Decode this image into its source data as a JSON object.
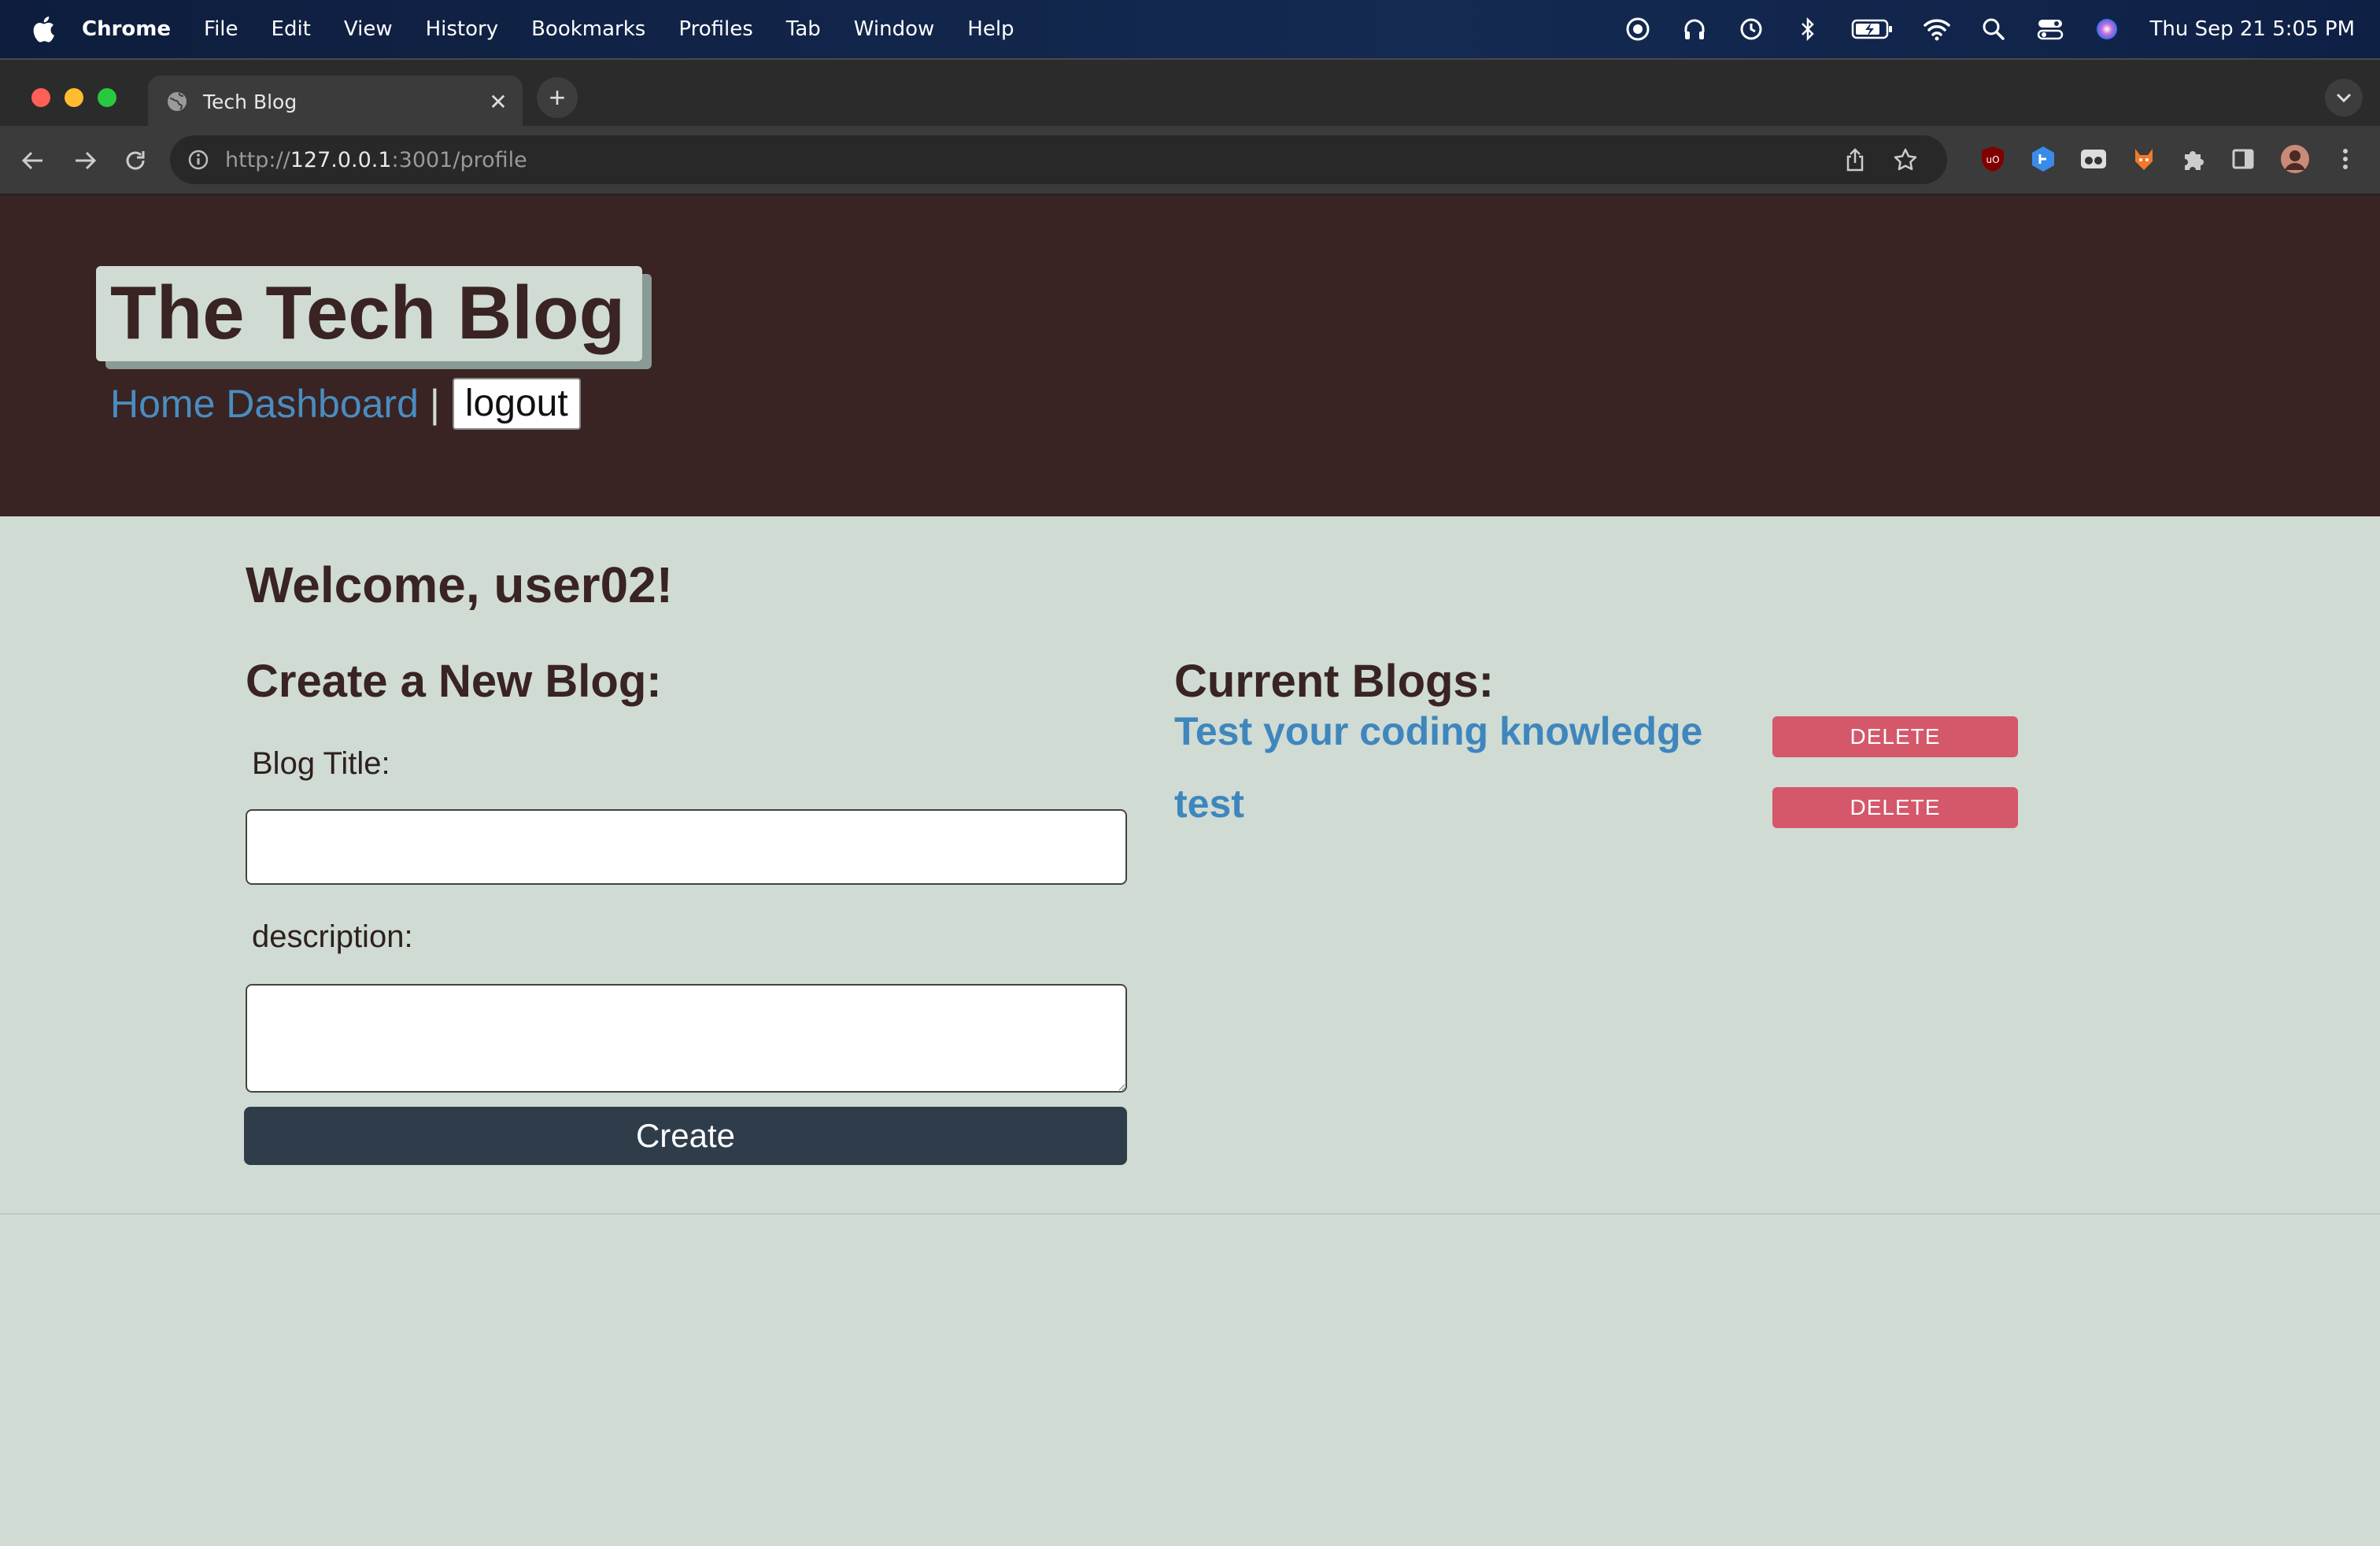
{
  "menubar": {
    "app_name": "Chrome",
    "items": [
      "File",
      "Edit",
      "View",
      "History",
      "Bookmarks",
      "Profiles",
      "Tab",
      "Window",
      "Help"
    ],
    "clock": "Thu Sep 21  5:05 PM"
  },
  "browser": {
    "tab_title": "Tech Blog",
    "tab_close": "✕",
    "new_tab": "+",
    "url_scheme": "http://",
    "url_host": "127.0.0.1",
    "url_path": ":3001/profile"
  },
  "header": {
    "brand": "The Tech Blog",
    "nav_home": "Home",
    "nav_dashboard": "Dashboard",
    "nav_separator": "|",
    "logout_label": "logout"
  },
  "main": {
    "welcome": "Welcome, user02!",
    "create_heading": "Create a New Blog:",
    "title_label": "Blog Title:",
    "title_value": "",
    "description_label": "description:",
    "description_value": "",
    "create_label": "Create",
    "current_heading": "Current Blogs:",
    "blogs": [
      {
        "title": "Test your coding knowledge",
        "delete_label": "DELETE"
      },
      {
        "title": "test",
        "delete_label": "DELETE"
      }
    ]
  },
  "colors": {
    "header_bg": "#392323",
    "page_bg": "#cfdbd3",
    "link": "#3f86bd",
    "delete": "#d4586a",
    "create_button": "#2f3d4b"
  }
}
